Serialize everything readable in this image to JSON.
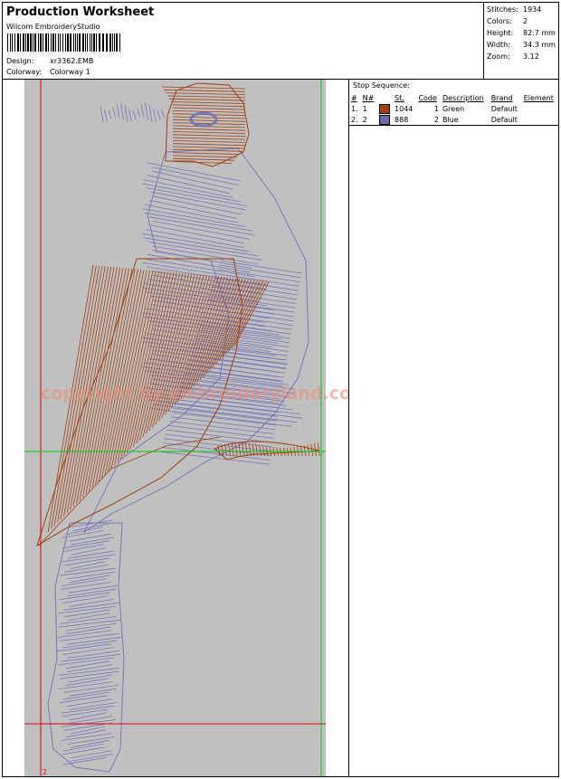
{
  "header": {
    "title": "Production Worksheet",
    "software": "Wilcom EmbroideryStudio",
    "design_label": "Design:",
    "design_value": "xr3362.EMB",
    "colorway_label": "Colorway:",
    "colorway_value": "Colorway 1"
  },
  "stats": [
    {
      "label": "Stitches:",
      "value": "1934"
    },
    {
      "label": "Colors:",
      "value": "2"
    },
    {
      "label": "Height:",
      "value": "82.7 mm"
    },
    {
      "label": "Width:",
      "value": "34.3 mm"
    },
    {
      "label": "Zoom:",
      "value": "3.12"
    }
  ],
  "canvas": {
    "watermark": "copyright by embroideryland.com",
    "marker_label": "2",
    "colors": {
      "background": "#c0c0c0",
      "blue_thread": "#7878b8",
      "brown_thread": "#a04010",
      "red_guide": "#e00000",
      "green_guide": "#00cc00"
    }
  },
  "stop_sequence": {
    "title": "Stop Sequence:",
    "columns": [
      "#",
      "N#",
      "St.",
      "Code",
      "Description",
      "Brand",
      "Element"
    ],
    "rows": [
      {
        "num": "1.",
        "n": "1",
        "color": "#a0400f",
        "st": "1044",
        "code": "1",
        "description": "Green",
        "brand": "Default",
        "element": ""
      },
      {
        "num": "2.",
        "n": "2",
        "color": "#6a6aa8",
        "st": "888",
        "code": "2",
        "description": "Blue",
        "brand": "Default",
        "element": ""
      }
    ]
  }
}
